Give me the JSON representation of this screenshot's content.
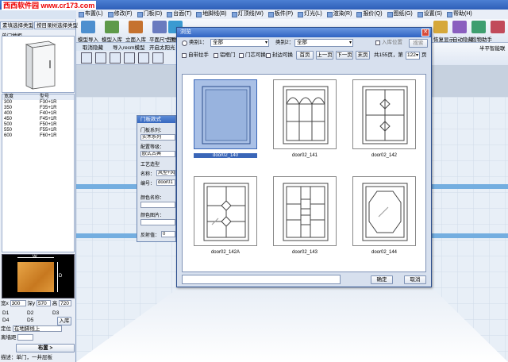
{
  "watermark": "西西软件园 www.cr173.com",
  "menu": [
    "布置(L)",
    "修改(F)",
    "门板(D)",
    "台面(T)",
    "地脚线(B)",
    "灯顶线(W)",
    "板件(P)",
    "灯光(L)",
    "渲染(R)",
    "报价(Q)",
    "图纸(G)",
    "设置(S)",
    "帮助(H)"
  ],
  "toolbar": {
    "labels_row1": [
      "模型导入",
      "模型入库",
      "立面入库",
      "平面尺寸图",
      "三维"
    ],
    "labels_row2": [
      "取消隐藏",
      "导入recm模型",
      "开启太阳光"
    ],
    "right_labels": [
      "恢复显示",
      "自动隐藏",
      "缆物助手",
      "半平智能联"
    ]
  },
  "left_panel": {
    "tabs": [
      "素填选择类型",
      "按目录树选择类型"
    ],
    "category": "单门地柜",
    "list_headers": [
      "宽度",
      "型号"
    ],
    "list_rows": [
      [
        "300",
        "F30+1R"
      ],
      [
        "350",
        "F35+1R"
      ],
      [
        "400",
        "F40+1R"
      ],
      [
        "450",
        "F45+1R"
      ],
      [
        "500",
        "F50+1R"
      ],
      [
        "550",
        "F55+1R"
      ],
      [
        "600",
        "F60+1R"
      ]
    ],
    "preview_labels": {
      "w": "W",
      "d": "D"
    },
    "dims": {
      "width_label": "宽x",
      "width": "300",
      "depth_label": "深y",
      "depth": "570",
      "height_label": "高",
      "height": "720",
      "d1": "D1",
      "d2": "D2",
      "d3": "D3",
      "d4": "D4",
      "d5": "D5",
      "button_ok": "入库",
      "position_label": "定位",
      "position_value": "在地脚线上",
      "corner_label": "离墙距",
      "place_button": "布置 >",
      "status": "描述：单门，一井层板"
    }
  },
  "door_dialog": {
    "title": "门板款式",
    "lines": [
      "门板系列：",
      "实木系列",
      "配置等级：",
      "欧式古典",
      "工艺造型",
      "名称：",
      "风型+风",
      "编号：",
      "door01",
      "颜色名称：",
      "颜色图片：",
      "反射值："
    ],
    "reflect": "0"
  },
  "picker": {
    "title": "浏览",
    "category_label": "类别1：",
    "category_value": "全部",
    "category2_label": "类别2：",
    "category2_value": "全部",
    "checkbox_label": "入库位置",
    "search_button": "搜索",
    "filters": [
      "自带拉手",
      "铝框门",
      "门芯可换",
      "封边可换"
    ],
    "nav": [
      "首页",
      "上一页",
      "下一页",
      "末页"
    ],
    "page_info_prefix": "共155页，第",
    "page_value": "122",
    "page_suffix": "页",
    "items": [
      "door02_140",
      "door02_141",
      "door02_142",
      "door02_142A",
      "door02_143",
      "door02_144"
    ],
    "ok": "确定",
    "cancel": "取消"
  },
  "colors": {
    "accent": "#2f63c2",
    "selected": "#3a66b8"
  }
}
